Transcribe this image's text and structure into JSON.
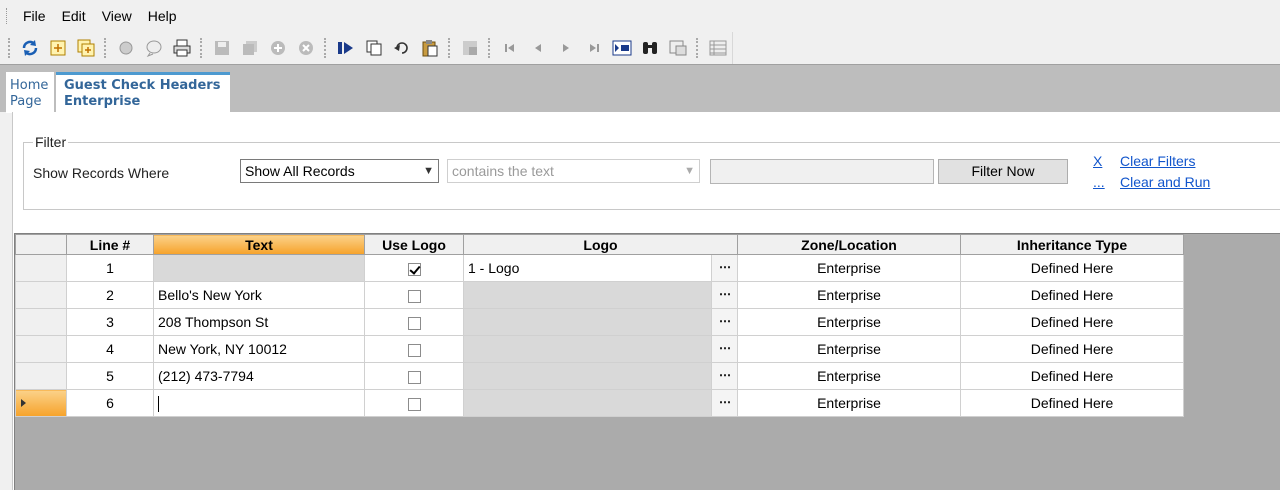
{
  "menu": [
    "File",
    "Edit",
    "View",
    "Help"
  ],
  "toolbar": {
    "icons": [
      "refresh-icon",
      "new-icon",
      "new-multiple-icon",
      "circle-icon",
      "notes-icon",
      "print-icon",
      "save-icon",
      "save-all-icon",
      "add-icon",
      "delete-icon",
      "run-icon",
      "copy-icon",
      "undo-icon",
      "paste-icon",
      "layout-icon",
      "first-record-icon",
      "previous-record-icon",
      "next-record-icon",
      "last-record-icon",
      "goto-record-icon",
      "find-icon",
      "window-icon",
      "list-icon"
    ]
  },
  "tabs": [
    {
      "line1": "Home",
      "line2": "Page"
    },
    {
      "line1": "Guest Check Headers",
      "line2": "Enterprise"
    }
  ],
  "filter": {
    "legend": "Filter",
    "show_label": "Show Records Where",
    "field_select": "Show All Records",
    "operator_select": "contains the text",
    "value": "",
    "filter_button": "Filter Now",
    "x_link": "X",
    "dots_link": "...",
    "clear_filters": "Clear Filters",
    "clear_and_run": "Clear and Run"
  },
  "grid": {
    "columns": [
      "Line #",
      "Text",
      "Use Logo",
      "Logo",
      "Zone/Location",
      "Inheritance Type"
    ],
    "ellipsis": "⋯",
    "rows": [
      {
        "line": "1",
        "text": "",
        "use_logo": true,
        "logo": "1 - Logo",
        "zone": "Enterprise",
        "inheritance": "Defined Here"
      },
      {
        "line": "2",
        "text": "Bello's New York",
        "use_logo": false,
        "logo": "",
        "zone": "Enterprise",
        "inheritance": "Defined Here"
      },
      {
        "line": "3",
        "text": "208 Thompson St",
        "use_logo": false,
        "logo": "",
        "zone": "Enterprise",
        "inheritance": "Defined Here"
      },
      {
        "line": "4",
        "text": "New York, NY 10012",
        "use_logo": false,
        "logo": "",
        "zone": "Enterprise",
        "inheritance": "Defined Here"
      },
      {
        "line": "5",
        "text": "(212) 473-7794",
        "use_logo": false,
        "logo": "",
        "zone": "Enterprise",
        "inheritance": "Defined Here"
      },
      {
        "line": "6",
        "text": "",
        "use_logo": false,
        "logo": "",
        "zone": "Enterprise",
        "inheritance": "Defined Here"
      }
    ]
  }
}
